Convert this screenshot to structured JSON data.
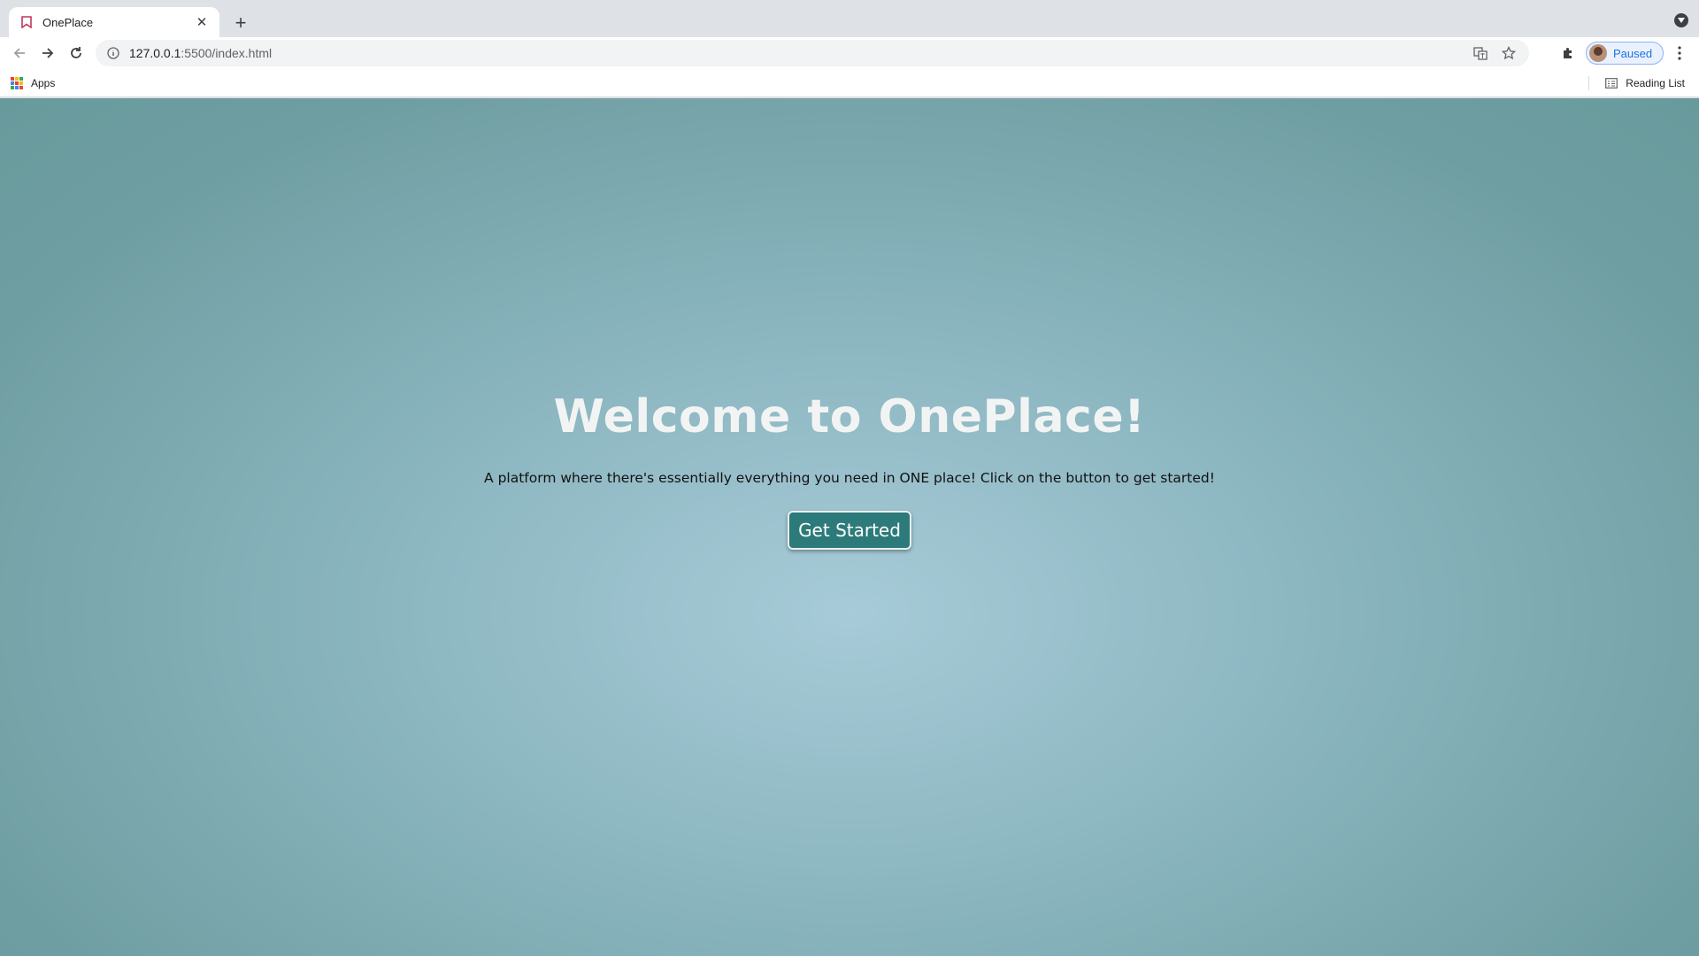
{
  "browser": {
    "tab": {
      "title": "OnePlace"
    },
    "address": {
      "host": "127.0.0.1",
      "path": ":5500/index.html"
    },
    "profile": {
      "label": "Paused"
    },
    "bookmarks": {
      "apps_label": "Apps",
      "reading_list_label": "Reading List"
    }
  },
  "page": {
    "title": "Welcome to OnePlace!",
    "subtitle": "A platform where there's essentially everything you need in ONE place! Click on the button to get started!",
    "cta_label": "Get Started"
  },
  "colors": {
    "accent": "#2d7a7a",
    "background_center": "#a7cbd8",
    "background_edge": "#689a9c",
    "title": "#f2f4f4"
  }
}
